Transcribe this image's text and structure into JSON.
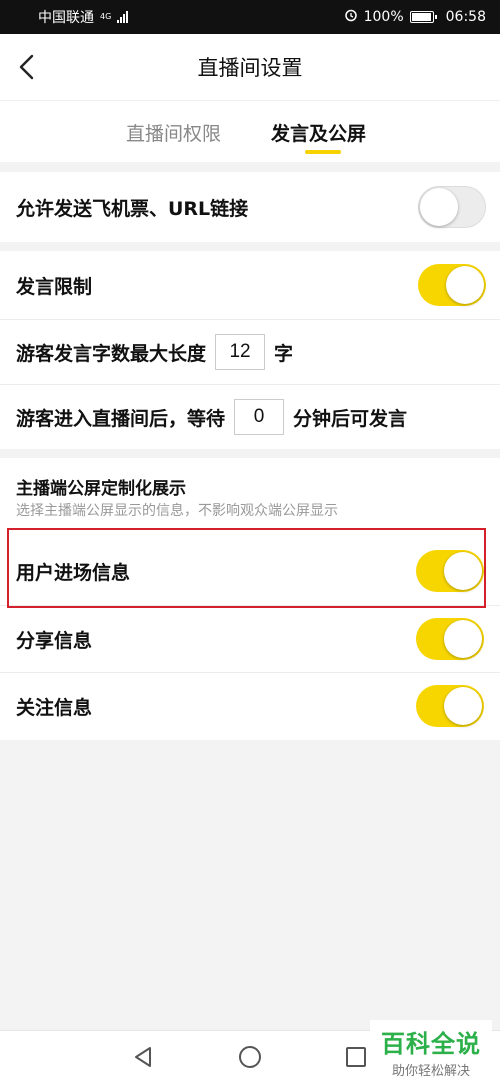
{
  "status_bar": {
    "carrier": "中国联通",
    "network": "4G",
    "alarm_icon": "alarm-clock-icon",
    "battery_percent": "100%",
    "battery_level": 1.0,
    "time": "06:58"
  },
  "header": {
    "back_icon": "chevron-left-icon",
    "title": "直播间设置"
  },
  "tabs": [
    {
      "label": "直播间权限",
      "active": false
    },
    {
      "label": "发言及公屏",
      "active": true
    }
  ],
  "settings": {
    "allow_links": {
      "label": "允许发送飞机票、URL链接",
      "enabled": false
    },
    "speech_limit": {
      "label": "发言限制",
      "enabled": true
    },
    "guest_max_length": {
      "label": "游客发言字数最大长度",
      "value": "12",
      "suffix": "字"
    },
    "guest_wait": {
      "label": "游客进入直播间后，等待",
      "value": "0",
      "suffix": "分钟后可发言"
    }
  },
  "custom_screen": {
    "title": "主播端公屏定制化展示",
    "subtitle": "选择主播端公屏显示的信息，不影响观众端公屏显示",
    "items": [
      {
        "label": "用户进场信息",
        "enabled": true
      },
      {
        "label": "分享信息",
        "enabled": true
      },
      {
        "label": "关注信息",
        "enabled": true
      }
    ]
  },
  "navigation": {
    "back": "triangle-back-icon",
    "home": "circle-home-icon",
    "recent": "square-recent-icon"
  },
  "watermark": {
    "main": "百科全说",
    "sub": "助你轻松解决"
  },
  "colors": {
    "accent_yellow": "#f7d600",
    "highlight_red": "#d4202b"
  }
}
